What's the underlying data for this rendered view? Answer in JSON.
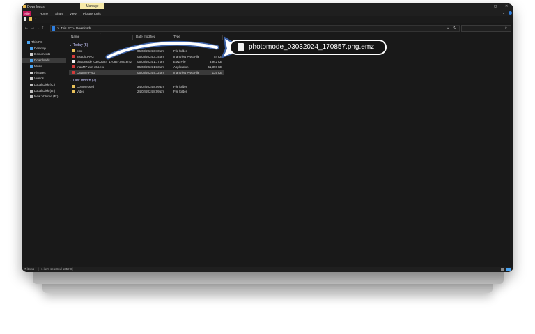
{
  "window": {
    "title": "Downloads",
    "manage_tab": "Manage",
    "ctl_min": "—",
    "ctl_max": "◻",
    "ctl_close": "✕"
  },
  "ribbon": {
    "tabs": [
      "File",
      "Home",
      "Share",
      "View",
      "Picture Tools"
    ]
  },
  "address": {
    "segments": [
      "This PC",
      "Downloads"
    ],
    "sep": ">"
  },
  "nav": {
    "items": [
      {
        "label": "This PC",
        "icon": "this-pc-icon",
        "color": "#4aa3f0"
      },
      {
        "label": "Desktop",
        "icon": "desktop-icon",
        "color": "#4aa3f0"
      },
      {
        "label": "Documents",
        "icon": "documents-icon",
        "color": "#cfcfcf"
      },
      {
        "label": "Downloads",
        "icon": "downloads-icon",
        "color": "#4aa3f0"
      },
      {
        "label": "Music",
        "icon": "music-icon",
        "color": "#4aa3f0"
      },
      {
        "label": "Pictures",
        "icon": "pictures-icon",
        "color": "#cfcfcf"
      },
      {
        "label": "Videos",
        "icon": "videos-icon",
        "color": "#cfcfcf"
      },
      {
        "label": "Local Disk (C:)",
        "icon": "drive-icon",
        "color": "#bfbfbf"
      },
      {
        "label": "Local Disk (D:)",
        "icon": "drive-icon",
        "color": "#bfbfbf"
      },
      {
        "label": "New Volume (E:)",
        "icon": "drive-icon",
        "color": "#bfbfbf"
      }
    ]
  },
  "columns": {
    "name": "Name",
    "date": "Date modified",
    "type": "Type"
  },
  "groups": [
    {
      "label": "Today (5)",
      "rows": [
        {
          "name": "emz",
          "date": "06/03/2024 3:10 am",
          "type": "File folder",
          "size": "",
          "icon": "folder-icon",
          "color": "#e8c15a"
        },
        {
          "name": "test pic.PNG",
          "date": "06/03/2024 3:14 am",
          "type": "IrfanView PNG File",
          "size": "54 KB",
          "icon": "png-icon",
          "color": "#d33b3b"
        },
        {
          "name": "photomode_03032024_170857.png.emz",
          "date": "06/03/2024 1:17 am",
          "type": "EMZ File",
          "size": "3,942 KB",
          "icon": "file-icon",
          "color": "#efefef"
        },
        {
          "name": "IrfanMP-win-x64.exe",
          "date": "06/03/2024 1:33 am",
          "type": "Application",
          "size": "51,398 KB",
          "icon": "exe-icon",
          "color": "#d33b3b"
        },
        {
          "name": "Capture.PNG",
          "date": "06/03/2024 4:12 am",
          "type": "IrfanView PNG File",
          "size": "135 KB",
          "icon": "png-icon",
          "color": "#d33b3b"
        }
      ]
    },
    {
      "label": "Last month (2)",
      "rows": [
        {
          "name": "Compressed",
          "date": "24/02/2024 8:09 pm",
          "type": "File folder",
          "size": "",
          "icon": "folder-icon",
          "color": "#e8c15a"
        },
        {
          "name": "Video",
          "date": "24/02/2024 8:09 pm",
          "type": "File folder",
          "size": "",
          "icon": "folder-icon",
          "color": "#e8c15a"
        }
      ]
    }
  ],
  "status": {
    "items": "7 items",
    "selected": "1 item selected  135 KB"
  },
  "callout": {
    "filename": "photomode_03032024_170857.png.emz"
  }
}
